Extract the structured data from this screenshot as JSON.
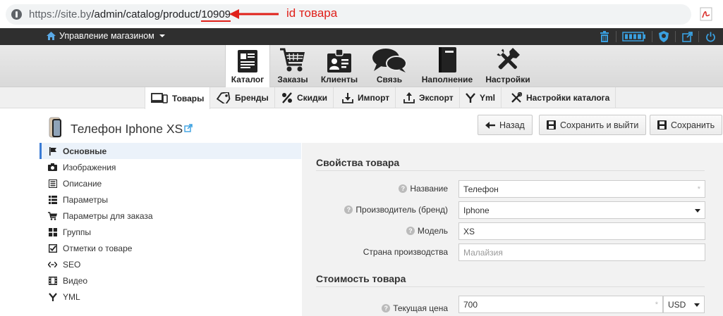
{
  "browser": {
    "url_prefix": "https://site.by",
    "url_path": "/admin/catalog/product/",
    "url_id": "10909",
    "annotation": "id товара"
  },
  "topbar": {
    "store_menu_label": "Управление магазином",
    "icons": [
      "trash-icon",
      "battery-icon",
      "shield-icon",
      "external-link-icon",
      "power-icon"
    ]
  },
  "modules": [
    {
      "label": "Каталог",
      "icon": "catalog-icon",
      "active": true
    },
    {
      "label": "Заказы",
      "icon": "cart-icon",
      "active": false
    },
    {
      "label": "Клиенты",
      "icon": "clients-icon",
      "active": false
    },
    {
      "label": "Связь",
      "icon": "chat-icon",
      "active": false
    },
    {
      "label": "Наполнение",
      "icon": "book-icon",
      "active": false
    },
    {
      "label": "Настройки",
      "icon": "tools-icon",
      "active": false
    }
  ],
  "subtabs": [
    {
      "label": "Товары",
      "icon": "devices-icon",
      "active": true
    },
    {
      "label": "Бренды",
      "icon": "tag-icon",
      "active": false
    },
    {
      "label": "Скидки",
      "icon": "percent-icon",
      "active": false
    },
    {
      "label": "Импорт",
      "icon": "import-icon",
      "active": false
    },
    {
      "label": "Экспорт",
      "icon": "export-icon",
      "active": false
    },
    {
      "label": "Yml",
      "icon": "yml-icon",
      "active": false
    },
    {
      "label": "Настройки каталога",
      "icon": "tools-icon",
      "active": false
    }
  ],
  "product": {
    "title": "Телефон Iphone XS"
  },
  "actions": {
    "back": "Назад",
    "save_exit": "Сохранить и выйти",
    "save": "Сохранить"
  },
  "leftmenu": [
    {
      "label": "Основные",
      "icon": "flag-icon",
      "active": true
    },
    {
      "label": "Изображения",
      "icon": "camera-icon",
      "active": false
    },
    {
      "label": "Описание",
      "icon": "document-icon",
      "active": false
    },
    {
      "label": "Параметры",
      "icon": "list-icon",
      "active": false
    },
    {
      "label": "Параметры для заказа",
      "icon": "cart-icon",
      "active": false
    },
    {
      "label": "Группы",
      "icon": "grid-icon",
      "active": false
    },
    {
      "label": "Отметки о товаре",
      "icon": "checkbox-icon",
      "active": false
    },
    {
      "label": "SEO",
      "icon": "code-icon",
      "active": false
    },
    {
      "label": "Видео",
      "icon": "film-icon",
      "active": false
    },
    {
      "label": "YML",
      "icon": "yml-icon",
      "active": false
    }
  ],
  "form": {
    "section_properties": "Свойства товара",
    "name_label": "Название",
    "name_value": "Телефон",
    "brand_label": "Производитель (бренд)",
    "brand_value": "Iphone",
    "model_label": "Модель",
    "model_value": "XS",
    "country_label": "Страна производства",
    "country_placeholder": "Малайзия",
    "section_price": "Стоимость товара",
    "price_label": "Текущая цена",
    "price_value": "700",
    "currency_value": "USD",
    "required_mark": "*"
  }
}
